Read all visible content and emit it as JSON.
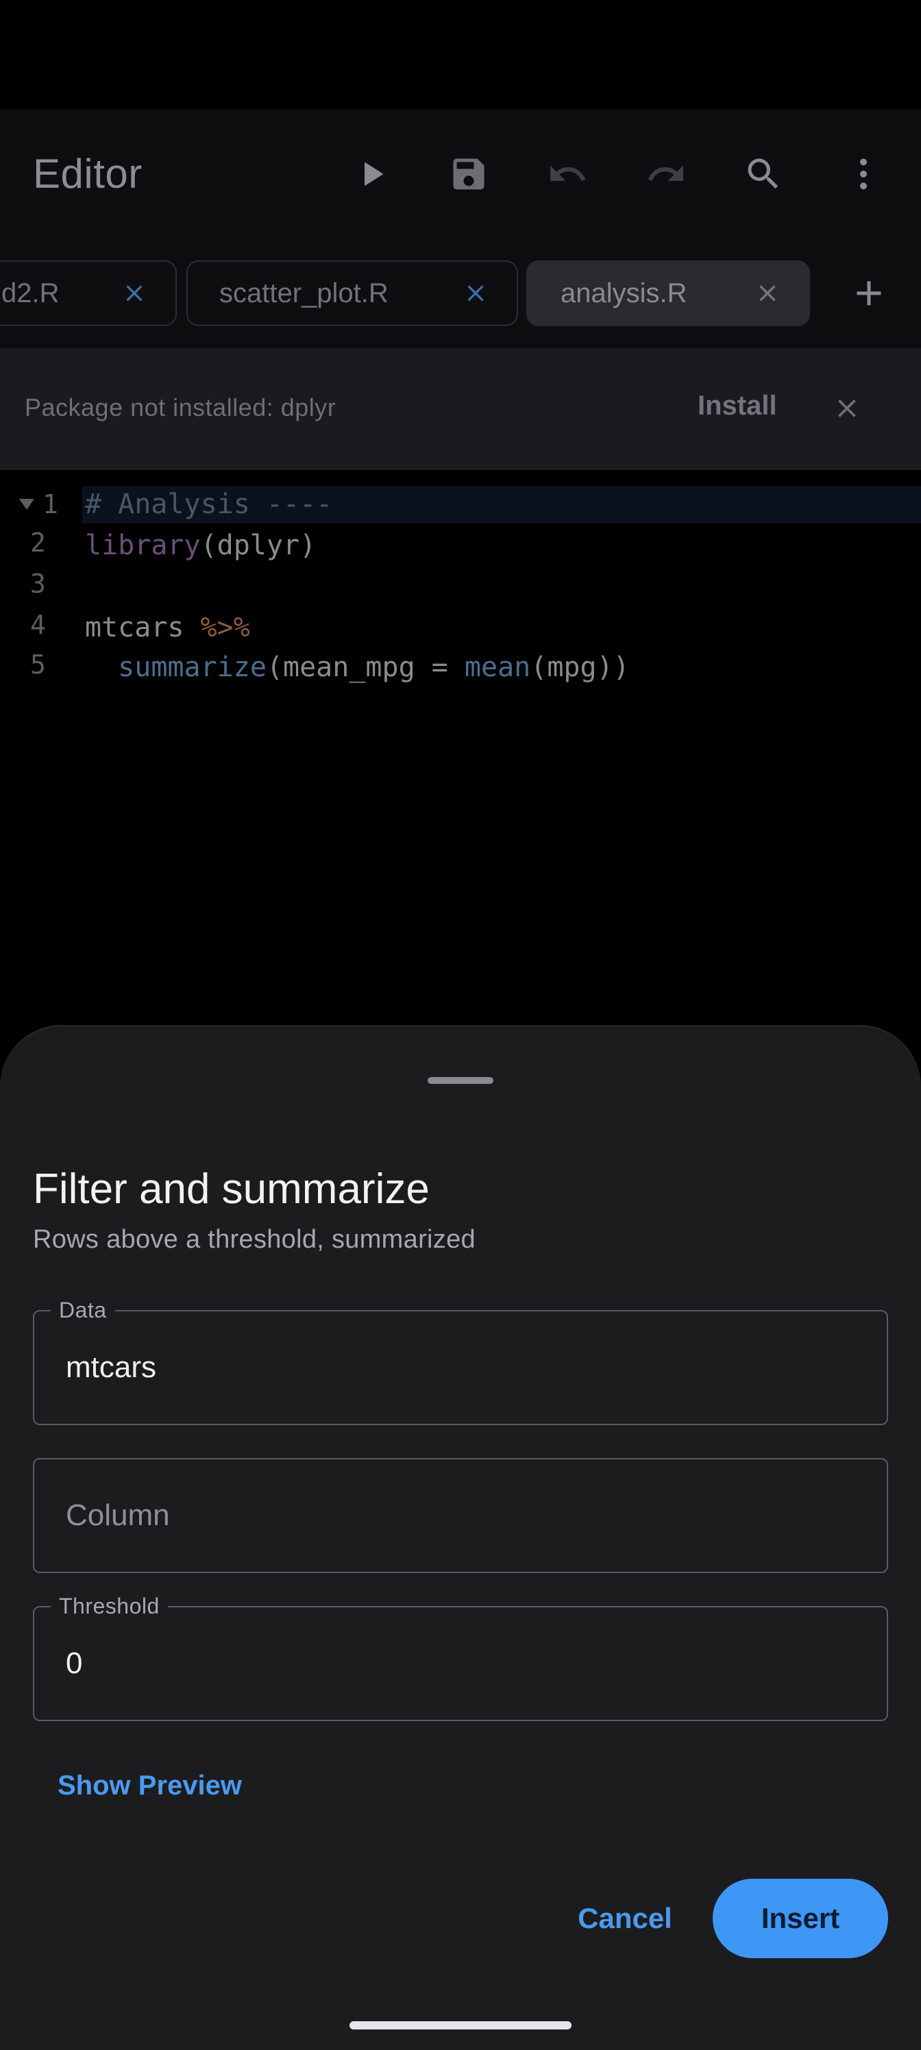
{
  "app_bar": {
    "title": "Editor",
    "icons": [
      "play-icon",
      "save-icon",
      "undo-icon",
      "redo-icon",
      "search-icon",
      "more-vert-icon"
    ]
  },
  "tabs": [
    {
      "label": "d2.R",
      "active": false
    },
    {
      "label": "scatter_plot.R",
      "active": false
    },
    {
      "label": "analysis.R",
      "active": true
    }
  ],
  "banner": {
    "message": "Package not installed: dplyr",
    "action": "Install"
  },
  "editor": {
    "line_numbers": [
      "1",
      "2",
      "3",
      "4",
      "5"
    ],
    "lines": {
      "l1_comment": "# Analysis ----",
      "l2_fn": "library",
      "l2_rest": "(dplyr)",
      "l4_obj": "mtcars ",
      "l4_op": "%>%",
      "l5_indent": "  ",
      "l5_fn": "summarize",
      "l5_mid": "(mean_mpg = ",
      "l5_fn2": "mean",
      "l5_end": "(mpg))"
    }
  },
  "sheet": {
    "title": "Filter and summarize",
    "subtitle": "Rows above a threshold, summarized",
    "fields": {
      "data": {
        "label": "Data",
        "value": "mtcars"
      },
      "column": {
        "placeholder": "Column",
        "value": ""
      },
      "threshold": {
        "label": "Threshold",
        "value": "0"
      }
    },
    "preview_label": "Show Preview",
    "cancel_label": "Cancel",
    "insert_label": "Insert"
  },
  "colors": {
    "accent": "#3f97f5",
    "link": "#4a9af0",
    "sheet_bg": "#1c1c1f"
  }
}
